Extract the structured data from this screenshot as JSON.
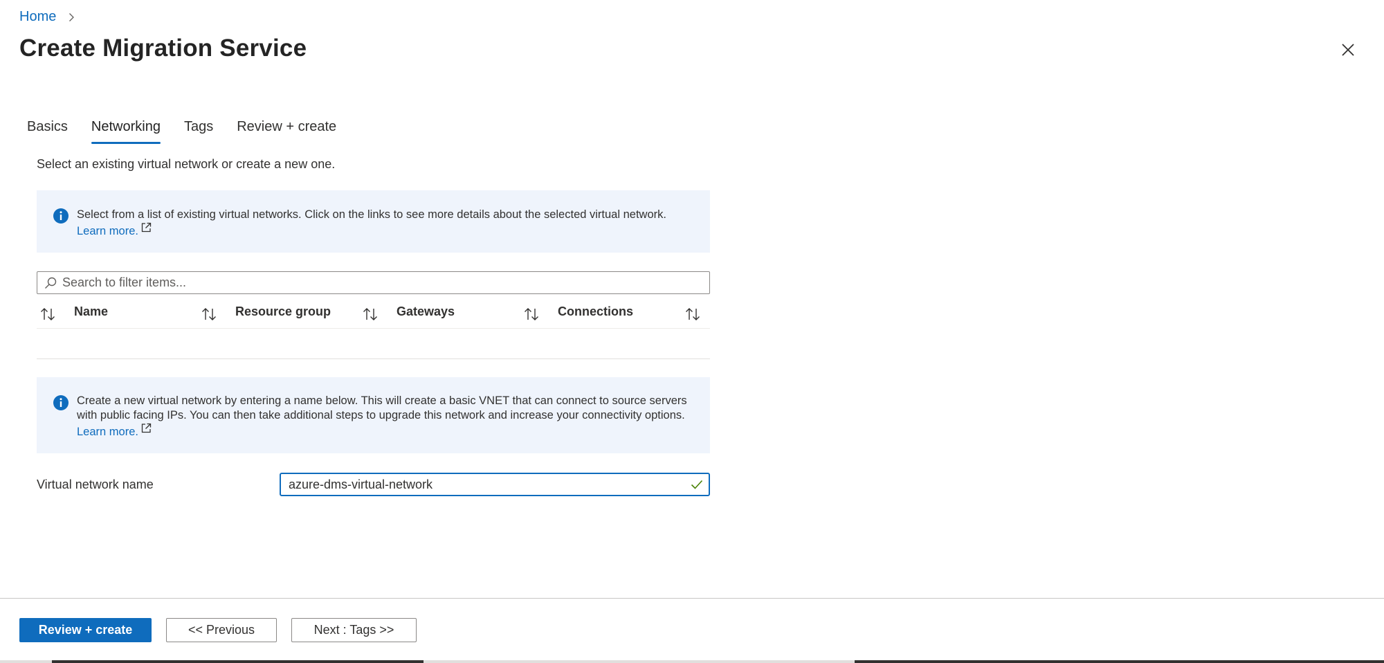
{
  "breadcrumb": {
    "home": "Home"
  },
  "page": {
    "title": "Create Migration Service"
  },
  "tabs": [
    {
      "label": "Basics",
      "active": false
    },
    {
      "label": "Networking",
      "active": true
    },
    {
      "label": "Tags",
      "active": false
    },
    {
      "label": "Review + create",
      "active": false
    }
  ],
  "networking": {
    "intro": "Select an existing virtual network or create a new one.",
    "info_existing": {
      "text": "Select from a list of existing virtual networks. Click on the links to see more details about the selected virtual network.",
      "link": "Learn more."
    },
    "search": {
      "placeholder": "Search to filter items..."
    },
    "grid": {
      "columns": [
        "Name",
        "Resource group",
        "Gateways",
        "Connections"
      ],
      "rows": []
    },
    "info_new": {
      "text": "Create a new virtual network by entering a name below. This will create a basic VNET that can connect to source servers with public facing IPs. You can then take additional steps to upgrade this network and increase your connectivity options.",
      "link": "Learn more."
    },
    "vnet": {
      "label": "Virtual network name",
      "value": "azure-dms-virtual-network",
      "valid": true
    }
  },
  "footer": {
    "review_create": "Review + create",
    "previous": "<< Previous",
    "next": "Next : Tags >>"
  },
  "colors": {
    "accent": "#0f6cbd",
    "info_background": "#eff4fc",
    "valid_check": "#498205"
  },
  "icons": {
    "breadcrumb_separator": "chevron-right-icon",
    "close": "close-icon",
    "info": "info-icon",
    "external_link": "external-link-icon",
    "search": "search-icon",
    "sort": "sort-icon",
    "valid": "checkmark-icon"
  }
}
